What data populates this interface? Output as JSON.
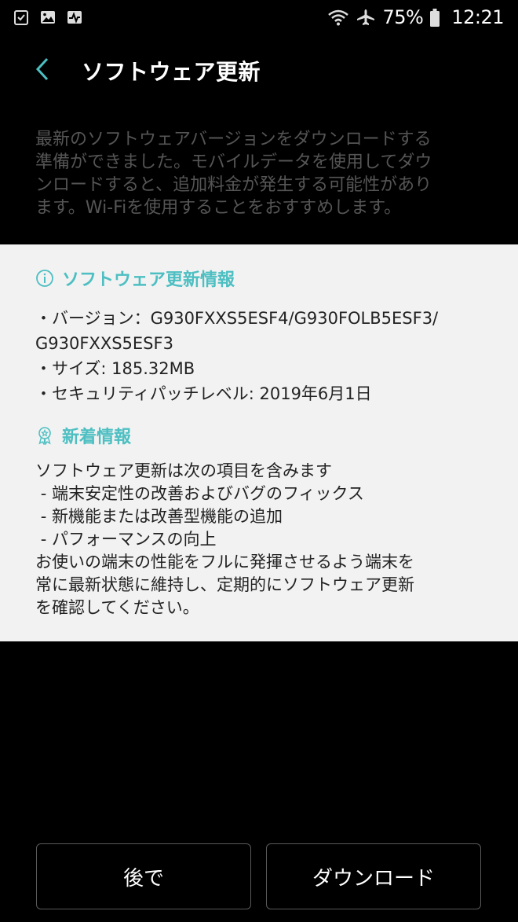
{
  "status_bar": {
    "left_icons": [
      "task-icon",
      "image-icon",
      "activity-icon"
    ],
    "right_icons": [
      "wifi-icon",
      "airplane-icon",
      "battery-icon"
    ],
    "battery": "75%",
    "time": "12:21"
  },
  "header": {
    "title": "ソフトウェア更新",
    "back_icon": "chevron-left-icon"
  },
  "notice": {
    "lines": [
      "最新のソフトウェアバージョンをダウンロードする",
      "準備ができました。モバイルデータを使用してダウ",
      "ンロードすると、追加料金が発生する可能性があり",
      "ます。Wi-Fiを使用することをおすすめします。"
    ]
  },
  "info": {
    "heading": "ソフトウェア更新情報",
    "heading_icon": "info-icon",
    "rows": [
      "・バージョン：G930FXXS5ESF4/G930FOLB5ESF3/",
      "G930FXXS5ESF3",
      "・サイズ: 185.32MB",
      "・セキュリティパッチレベル: 2019年6月1日"
    ]
  },
  "whats_new": {
    "heading": "新着情報",
    "heading_icon": "award-ribbon-icon",
    "lines": [
      "ソフトウェア更新は次の項目を含みます",
      " - 端末安定性の改善およびバグのフィックス",
      " - 新機能または改善型機能の追加",
      " - パフォーマンスの向上",
      "お使いの端末の性能をフルに発揮させるよう端末を",
      "常に最新状態に維持し、定期的にソフトウェア更新",
      "を確認してください。"
    ]
  },
  "buttons": {
    "later": "後で",
    "download": "ダウンロード"
  },
  "colors": {
    "accent": "#4dbfc2",
    "notice_text": "#555555",
    "card_bg": "#f2f2f2"
  }
}
